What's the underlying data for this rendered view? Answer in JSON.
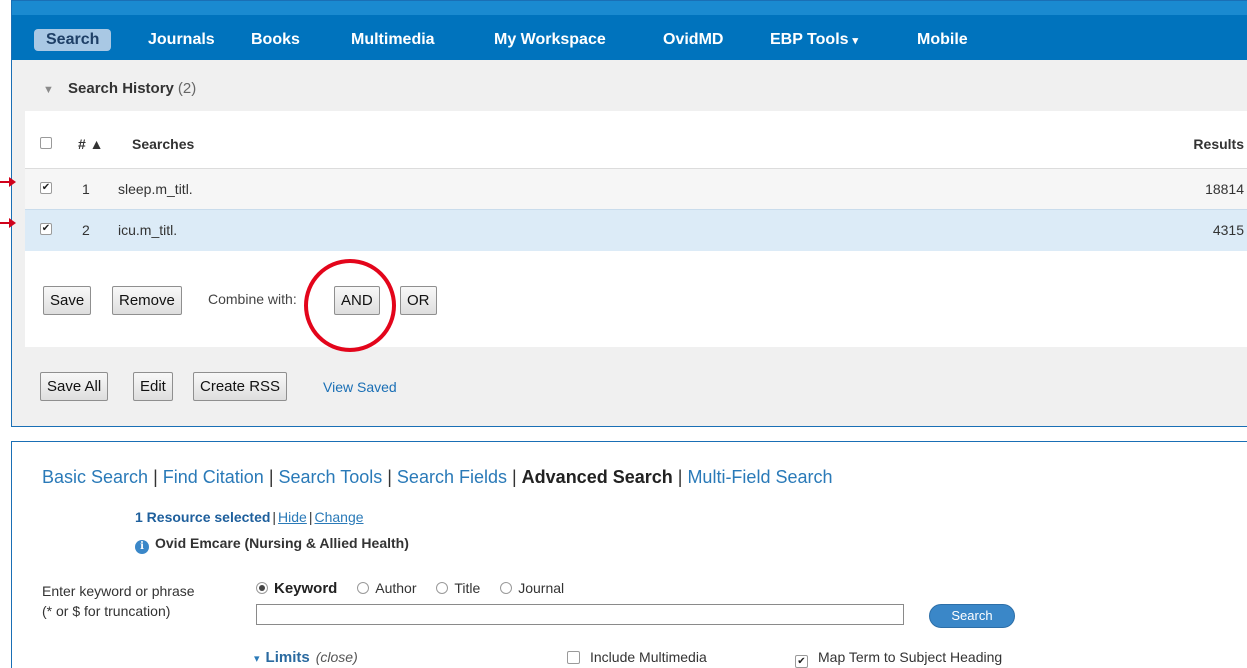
{
  "nav": {
    "items": [
      "Search",
      "Journals",
      "Books",
      "Multimedia",
      "My Workspace",
      "OvidMD",
      "EBP Tools",
      "Mobile"
    ],
    "caret": "▾"
  },
  "history": {
    "title": "Search History",
    "count": "(2)",
    "header": {
      "num": "# ▲",
      "searches": "Searches",
      "results": "Results"
    },
    "rows": [
      {
        "num": "1",
        "search": "sleep.m_titl.",
        "results": "18814"
      },
      {
        "num": "2",
        "search": "icu.m_titl.",
        "results": "4315"
      }
    ],
    "check_mark": "✔",
    "buttons": {
      "save": "Save",
      "remove": "Remove",
      "combine_label": "Combine with:",
      "and": "AND",
      "or": "OR"
    },
    "footer_buttons": {
      "save_all": "Save All",
      "edit": "Edit",
      "create_rss": "Create RSS",
      "view_saved": "View Saved"
    }
  },
  "search_panel": {
    "tabs": [
      "Basic Search",
      "Find Citation",
      "Search Tools",
      "Search Fields",
      "Advanced Search",
      "Multi-Field Search"
    ],
    "separator": "|",
    "resource": {
      "selected": "1 Resource selected",
      "hide": "Hide",
      "change": "Change",
      "bar": "|"
    },
    "database": "Ovid Emcare (Nursing & Allied Health)",
    "info_glyph": "i",
    "enter_label_1": "Enter keyword or phrase",
    "enter_label_2": "(* or $ for truncation)",
    "radios": [
      "Keyword",
      "Author",
      "Title",
      "Journal"
    ],
    "search_value": "",
    "search_button": "Search",
    "limits": {
      "tri": "▾",
      "label": "Limits",
      "close": "(close)"
    },
    "include_multimedia": "Include Multimedia",
    "map_term": "Map Term to Subject Heading"
  },
  "colors": {
    "nav_bg": "#0073bd",
    "accent": "#2a7ab8",
    "annotation_red": "#e3051b"
  }
}
